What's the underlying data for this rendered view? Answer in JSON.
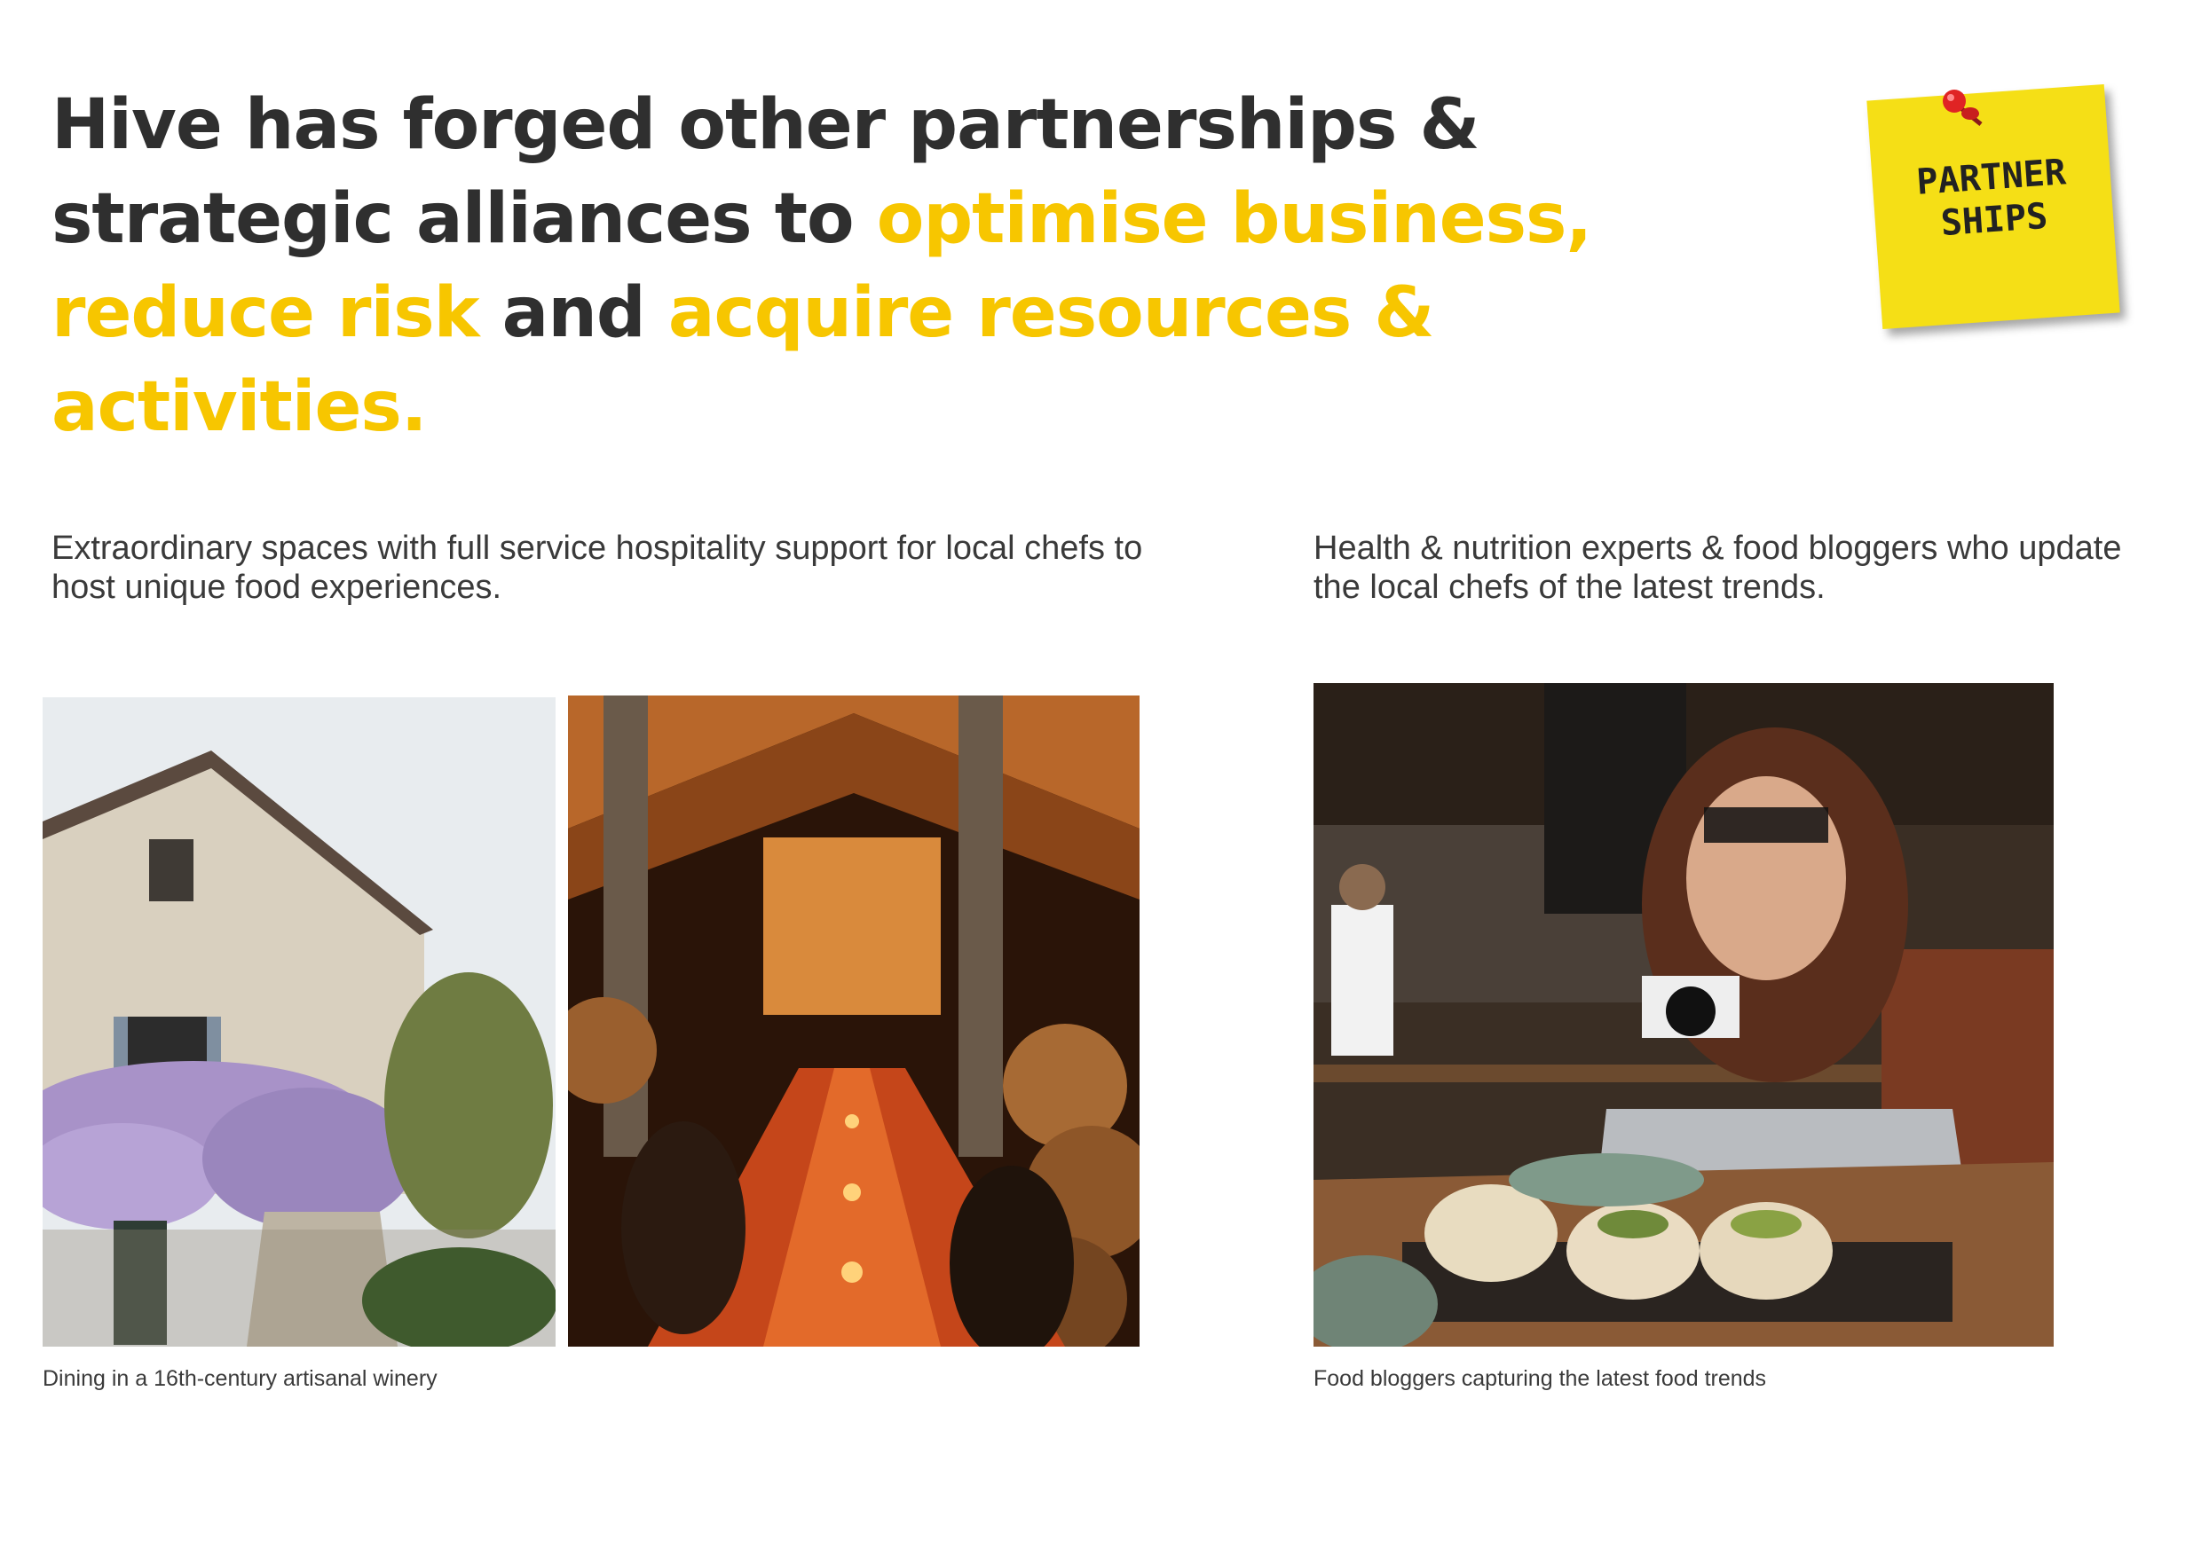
{
  "headline": {
    "part1": "Hive has forged other partnerships & strategic alliances to ",
    "highlight1": "optimise business, reduce risk",
    "part2": " and ",
    "highlight2": "acquire resources & activities."
  },
  "sticky_note": {
    "line1": "PARTNER",
    "line2": "SHIPS"
  },
  "left_section": {
    "description": "Extraordinary spaces with full service hospitality support for local chefs to host unique food experiences.",
    "caption": "Dining in a 16th-century artisanal winery"
  },
  "right_section": {
    "description": "Health & nutrition experts & food bloggers who update the local chefs of the latest trends.",
    "caption": "Food bloggers capturing the latest food trends"
  },
  "colors": {
    "accent": "#f7c600",
    "text": "#2f2f2f",
    "note": "#f5df16"
  }
}
